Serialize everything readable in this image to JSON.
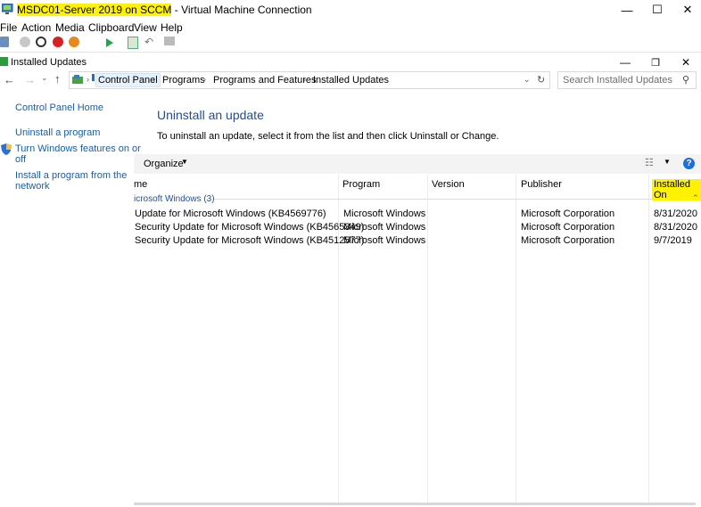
{
  "vm": {
    "title_highlight": "MSDC01-Server 2019 on SCCM",
    "title_rest": " - Virtual Machine Connection",
    "menu": [
      "File",
      "Action",
      "Media",
      "Clipboard",
      "View",
      "Help"
    ]
  },
  "explorer": {
    "title": "Installed Updates",
    "breadcrumbs": [
      "Control Panel",
      "Programs",
      "Programs and Features",
      "Installed Updates"
    ],
    "search_placeholder": "Search Installed Updates"
  },
  "left_pane": {
    "home": "Control Panel Home",
    "uninstall": "Uninstall a program",
    "features_line1": "Turn Windows features on or",
    "features_line2": "off",
    "network_line1": "Install a program from the",
    "network_line2": "network"
  },
  "main": {
    "heading": "Uninstall an update",
    "description": "To uninstall an update, select it from the list and then click Uninstall or Change.",
    "organize": "Organize",
    "columns": [
      "me",
      "Program",
      "Version",
      "Publisher",
      "Installed On"
    ],
    "group": "icrosoft Windows (3)",
    "rows": [
      {
        "name": "Update for Microsoft Windows (KB4569776)",
        "program": "Microsoft Windows",
        "version": "",
        "publisher": "Microsoft Corporation",
        "installed": "8/31/2020"
      },
      {
        "name": "Security Update for Microsoft Windows (KB4565349)",
        "program": "Microsoft Windows",
        "version": "",
        "publisher": "Microsoft Corporation",
        "installed": "8/31/2020"
      },
      {
        "name": "Security Update for Microsoft Windows (KB4512577)",
        "program": "Microsoft Windows",
        "version": "",
        "publisher": "Microsoft Corporation",
        "installed": "9/7/2019"
      }
    ]
  },
  "colors": {
    "link": "#1a5ea8",
    "highlight": "#fff200",
    "heading": "#1e4e99"
  }
}
